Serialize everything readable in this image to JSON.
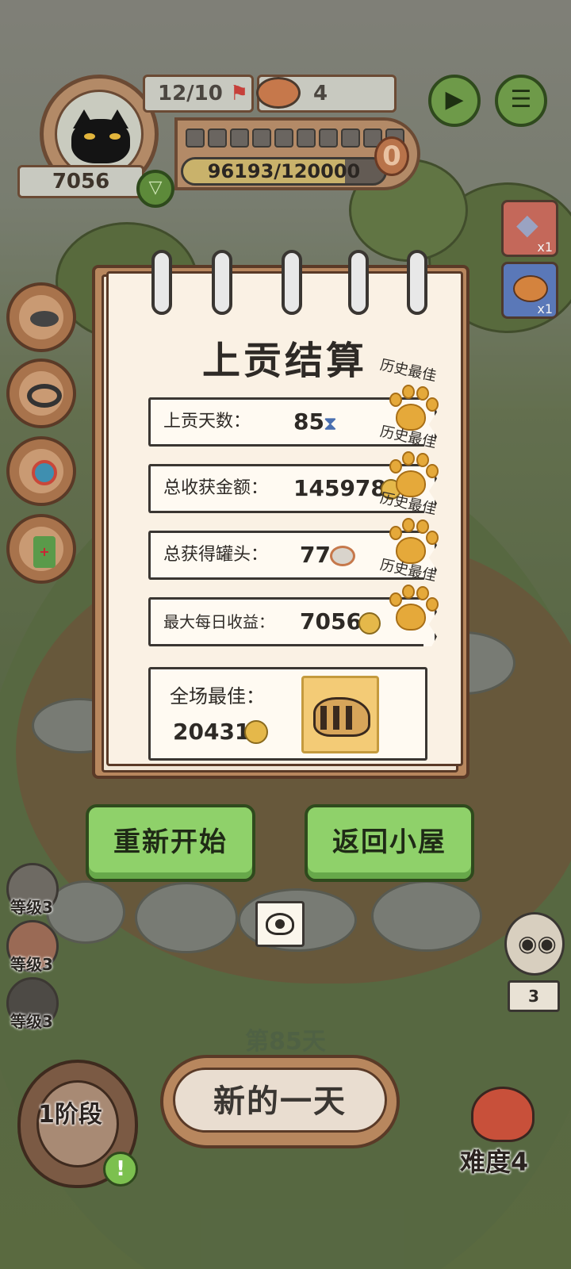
{
  "hud": {
    "gold": "7056",
    "tribute_count": "12/10",
    "cans": "4",
    "progress_text": "96193/120000",
    "progress": 0.802,
    "zero_badge": "0",
    "segments_total": 10
  },
  "side_items": [
    {
      "icon": "crystal-icon",
      "count": "x1",
      "color": "#c4685a"
    },
    {
      "icon": "meat-icon",
      "count": "x1",
      "color": "#5a78b8"
    }
  ],
  "levels": [
    {
      "label": "等级3"
    },
    {
      "label": "等级3"
    },
    {
      "label": "等级3"
    }
  ],
  "summary": {
    "title": "上贡结算",
    "best_label": "历史最佳",
    "rows": [
      {
        "label": "上贡天数：",
        "value": "85",
        "icon": "hourglass-icon",
        "best": true
      },
      {
        "label": "总收获金额：",
        "value": "145978",
        "icon": "paw-coin-icon",
        "best": true
      },
      {
        "label": "总获得罐头：",
        "value": "77",
        "icon": "can-icon",
        "best": true
      },
      {
        "label": "最大每日收益：",
        "value": "7056",
        "icon": "paw-coin-icon",
        "best": true
      }
    ],
    "overall_best": {
      "label": "全场最佳：",
      "value": "20431",
      "icon": "paw-coin-icon",
      "pet": "saber-tooth-tiger-icon"
    }
  },
  "buttons": {
    "restart": "重新开始",
    "back_home": "返回小屋",
    "new_day": "新的一天"
  },
  "footer": {
    "day": "第85天",
    "stage": "1阶段",
    "difficulty": "难度4",
    "owl_count": "3",
    "alert": "!"
  },
  "colors": {
    "accent_green": "#8fd16a",
    "paw_gold": "#e5a93a",
    "frame_brown": "#5a3a27"
  }
}
